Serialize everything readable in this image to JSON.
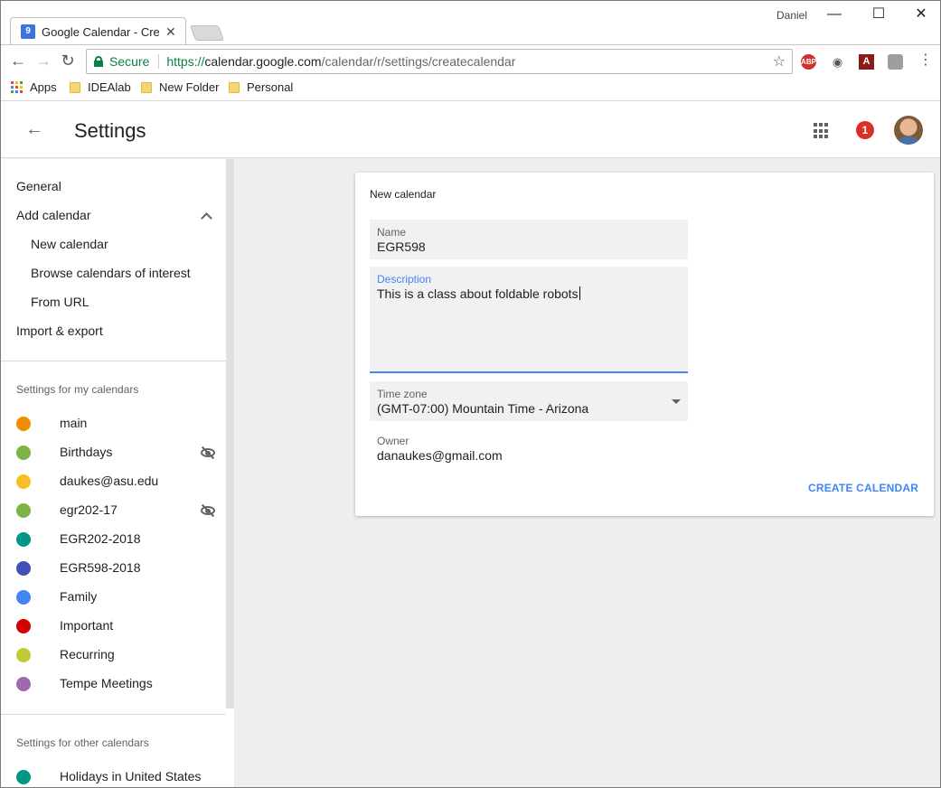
{
  "browser": {
    "tab_title": "Google Calendar - Create",
    "tab_favicon": "9",
    "user_name": "Daniel",
    "secure_label": "Secure",
    "url_scheme": "https://",
    "url_host": "calendar.google.com",
    "url_path": "/calendar/r/settings/createcalendar",
    "extensions": [
      "ABP",
      "eye-slash-icon",
      "pdf-icon",
      "shield-icon"
    ]
  },
  "bookmarks": [
    {
      "label": "Apps",
      "icon": "apps-grid-icon"
    },
    {
      "label": "IDEAlab",
      "icon": "folder-icon"
    },
    {
      "label": "New Folder",
      "icon": "folder-icon"
    },
    {
      "label": "Personal",
      "icon": "folder-icon"
    }
  ],
  "header": {
    "title": "Settings",
    "notification_count": "1"
  },
  "sidebar": {
    "general": "General",
    "add_calendar": "Add calendar",
    "new_calendar": "New calendar",
    "browse_calendars": "Browse calendars of interest",
    "from_url": "From URL",
    "import_export": "Import & export",
    "my_calendars_header": "Settings for my calendars",
    "my_calendars": [
      {
        "name": "main",
        "color": "#ef8c00",
        "hidden": false
      },
      {
        "name": "Birthdays",
        "color": "#7cb342",
        "hidden": true
      },
      {
        "name": "daukes@asu.edu",
        "color": "#f6bf26",
        "hidden": false
      },
      {
        "name": "egr202-17",
        "color": "#7cb342",
        "hidden": true
      },
      {
        "name": "EGR202-2018",
        "color": "#009688",
        "hidden": false
      },
      {
        "name": "EGR598-2018",
        "color": "#3f51b5",
        "hidden": false
      },
      {
        "name": "Family",
        "color": "#4285f4",
        "hidden": false
      },
      {
        "name": "Important",
        "color": "#d50000",
        "hidden": false
      },
      {
        "name": "Recurring",
        "color": "#c0ca33",
        "hidden": false
      },
      {
        "name": "Tempe Meetings",
        "color": "#9e69af",
        "hidden": false
      }
    ],
    "other_calendars_header": "Settings for other calendars",
    "other_calendars": [
      {
        "name": "Holidays in United States",
        "color": "#009688"
      }
    ]
  },
  "form": {
    "card_title": "New calendar",
    "name_label": "Name",
    "name_value": "EGR598",
    "description_label": "Description",
    "description_value": "This is a class about foldable robots",
    "timezone_label": "Time zone",
    "timezone_value": "(GMT-07:00) Mountain Time - Arizona",
    "owner_label": "Owner",
    "owner_value": "danaukes@gmail.com",
    "create_button": "CREATE CALENDAR"
  }
}
